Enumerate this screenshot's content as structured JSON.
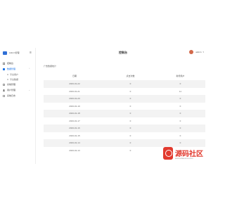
{
  "app": {
    "brand": "Admin管理",
    "title": "控制台",
    "user": {
      "name": "admin"
    }
  },
  "sidebar": {
    "items": [
      {
        "label": "控制台",
        "icon": "dashboard-icon",
        "active": false
      },
      {
        "label": "数据管理",
        "icon": "database-icon",
        "active": true,
        "expanded": true,
        "children": [
          {
            "label": "平台用户"
          },
          {
            "label": "平台数据"
          }
        ]
      },
      {
        "label": "系统管理",
        "icon": "settings-icon",
        "active": false
      },
      {
        "label": "用户管理",
        "icon": "user-icon",
        "active": false,
        "has_children": true
      },
      {
        "label": "系统日志",
        "icon": "log-icon",
        "active": false
      }
    ]
  },
  "main": {
    "section_title": "广告数据统计",
    "table": {
      "headers": [
        "日期",
        "点击次数",
        "新增用户"
      ],
      "rows": [
        [
          "2023-01-22",
          "0",
          "0"
        ],
        [
          "2023-01-21",
          "0",
          "11"
        ],
        [
          "2023-01-20",
          "0",
          "0"
        ],
        [
          "2023-01-19",
          "0",
          "0"
        ],
        [
          "2023-01-18",
          "0",
          "0"
        ],
        [
          "2023-01-17",
          "0",
          "0"
        ],
        [
          "2023-01-16",
          "0",
          "0"
        ],
        [
          "2023-01-15",
          "0",
          "0"
        ],
        [
          "2023-01-14",
          "0",
          "0"
        ],
        [
          "2023-01-13",
          "0",
          "0"
        ]
      ]
    }
  },
  "watermark": {
    "text": "源码社区",
    "sub": "www.ahaocms.com"
  },
  "colors": {
    "accent": "#1a73e8",
    "brand_mark": "#2f6fd6",
    "watermark_red": "#e23a2e",
    "row_stripe": "#f3f3f3"
  }
}
